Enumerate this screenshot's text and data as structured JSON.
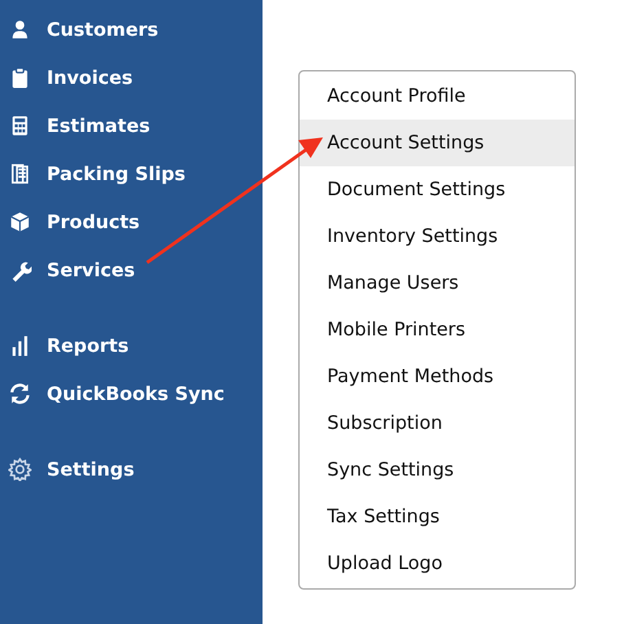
{
  "sidebar": {
    "groups": [
      {
        "items": [
          {
            "label": "Customers"
          },
          {
            "label": "Invoices"
          },
          {
            "label": "Estimates"
          },
          {
            "label": "Packing Slips"
          },
          {
            "label": "Products"
          },
          {
            "label": "Services"
          }
        ]
      },
      {
        "items": [
          {
            "label": "Reports"
          },
          {
            "label": "QuickBooks Sync"
          }
        ]
      },
      {
        "items": [
          {
            "label": "Settings"
          }
        ]
      }
    ]
  },
  "settings_menu": {
    "items": [
      {
        "label": "Account Profile",
        "selected": false
      },
      {
        "label": "Account Settings",
        "selected": true
      },
      {
        "label": "Document Settings",
        "selected": false
      },
      {
        "label": "Inventory Settings",
        "selected": false
      },
      {
        "label": "Manage Users",
        "selected": false
      },
      {
        "label": "Mobile Printers",
        "selected": false
      },
      {
        "label": "Payment Methods",
        "selected": false
      },
      {
        "label": "Subscription",
        "selected": false
      },
      {
        "label": "Sync Settings",
        "selected": false
      },
      {
        "label": "Tax Settings",
        "selected": false
      },
      {
        "label": "Upload Logo",
        "selected": false
      }
    ]
  }
}
